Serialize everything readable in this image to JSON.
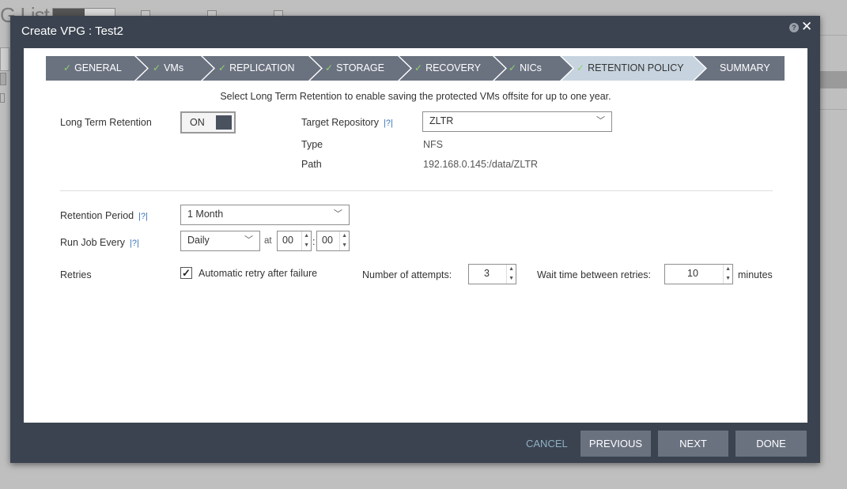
{
  "background": {
    "title": "G List"
  },
  "modal": {
    "title": "Create VPG : Test2"
  },
  "wizard": {
    "steps": [
      {
        "label": "GENERAL",
        "done": true
      },
      {
        "label": "VMs",
        "done": true
      },
      {
        "label": "REPLICATION",
        "done": true
      },
      {
        "label": "STORAGE",
        "done": true
      },
      {
        "label": "RECOVERY",
        "done": true
      },
      {
        "label": "NICs",
        "done": true
      },
      {
        "label": "RETENTION POLICY",
        "done": true,
        "active": true
      },
      {
        "label": "SUMMARY",
        "done": false
      }
    ],
    "check_symbol": "✓"
  },
  "note": "Select Long Term Retention to enable saving the protected VMs offsite for up to one year.",
  "ltr": {
    "label": "Long Term Retention",
    "toggle": "ON"
  },
  "repository": {
    "target_label": "Target Repository",
    "help": "|?|",
    "target_value": "ZLTR",
    "type_label": "Type",
    "type_value": "NFS",
    "path_label": "Path",
    "path_value": "192.168.0.145:/data/ZLTR"
  },
  "retention_period": {
    "label": "Retention Period",
    "help": "|?|",
    "value": "1 Month"
  },
  "run_job": {
    "label": "Run Job Every",
    "help": "|?|",
    "frequency": "Daily",
    "at": "at",
    "hour": "00",
    "sep": ":",
    "minute": "00"
  },
  "retries": {
    "label": "Retries",
    "checkbox_label": "Automatic retry after failure",
    "checked": true,
    "attempts_label": "Number of attempts:",
    "attempts_value": "3",
    "wait_label": "Wait time between retries:",
    "wait_value": "10",
    "wait_unit": "minutes"
  },
  "footer": {
    "cancel": "CANCEL",
    "previous": "PREVIOUS",
    "next": "NEXT",
    "done": "DONE"
  },
  "colors": {
    "modal_bg": "#3b4350",
    "step_done": "#6a7280",
    "step_active": "#c7d4df",
    "check": "#8fd16a"
  }
}
